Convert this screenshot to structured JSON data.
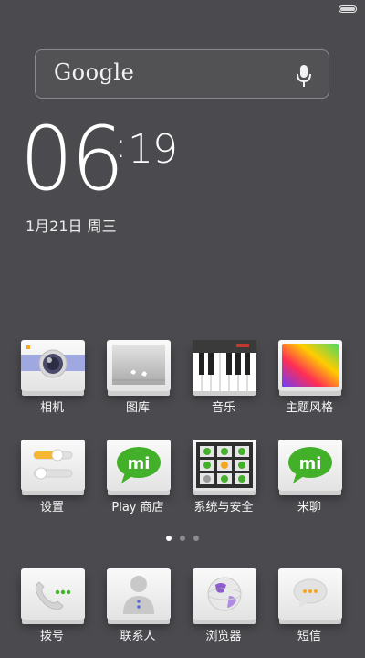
{
  "search": {
    "logo": "Google"
  },
  "clock": {
    "hour": "06",
    "colon": ":",
    "minute": "19",
    "date": "1月21日 周三"
  },
  "apps": [
    {
      "label": "相机",
      "icon": "camera-icon"
    },
    {
      "label": "图库",
      "icon": "gallery-icon"
    },
    {
      "label": "音乐",
      "icon": "piano-icon"
    },
    {
      "label": "主题风格",
      "icon": "theme-icon"
    },
    {
      "label": "设置",
      "icon": "settings-icon"
    },
    {
      "label": "Play 商店",
      "icon": "mi-store-icon"
    },
    {
      "label": "系统与安全",
      "icon": "system-grid-icon"
    },
    {
      "label": "米聊",
      "icon": "mi-chat-icon"
    }
  ],
  "dock": [
    {
      "label": "拨号",
      "icon": "phone-icon"
    },
    {
      "label": "联系人",
      "icon": "contacts-icon"
    },
    {
      "label": "浏览器",
      "icon": "browser-icon"
    },
    {
      "label": "短信",
      "icon": "messages-icon"
    }
  ],
  "pager": {
    "pages": 3,
    "active": 0
  },
  "colors": {
    "background": "#4b4b4f",
    "mi_green": "#43b02a",
    "theme_gradient": [
      "#ff3b30",
      "#ffcc00",
      "#34c759",
      "#5856d6"
    ]
  }
}
